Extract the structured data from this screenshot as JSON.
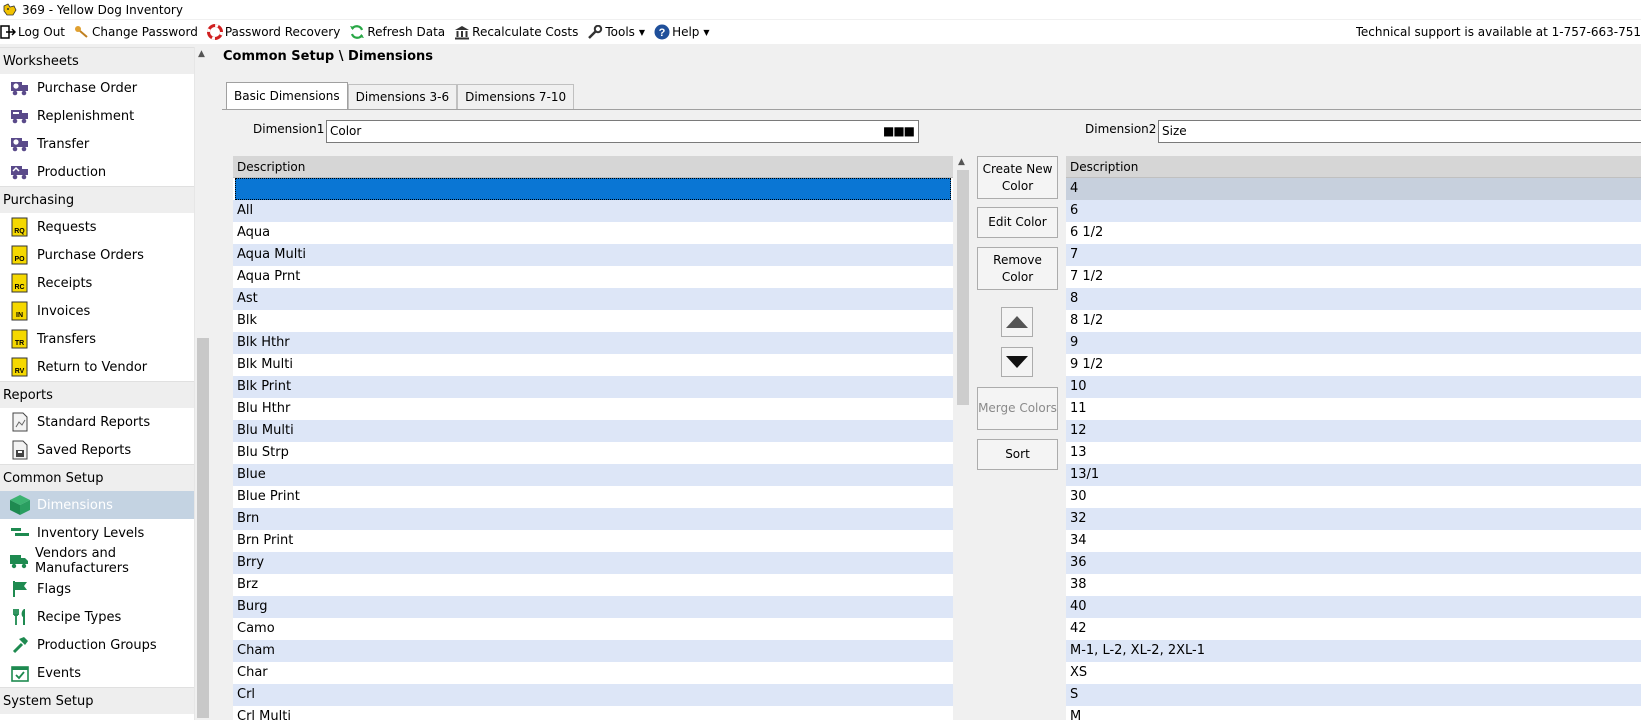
{
  "window": {
    "title": "369  - Yellow Dog Inventory"
  },
  "menubar": {
    "items": [
      {
        "label": "Log Out",
        "icon": "logout-icon"
      },
      {
        "label": "Change Password",
        "icon": "key-icon"
      },
      {
        "label": "Password Recovery",
        "icon": "lifebuoy-icon"
      },
      {
        "label": "Refresh Data",
        "icon": "refresh-icon"
      },
      {
        "label": "Recalculate Costs",
        "icon": "bank-icon"
      },
      {
        "label": "Tools",
        "icon": "wrench-icon"
      },
      {
        "label": "Help",
        "icon": "help-icon"
      }
    ],
    "support_text": "Technical support is available at 1-757-663-751"
  },
  "sidebar": {
    "sections": [
      {
        "header": "Worksheets",
        "items": [
          {
            "label": "Purchase Order",
            "icon": "worksheet-truck-icon"
          },
          {
            "label": "Replenishment",
            "icon": "worksheet-truck-icon"
          },
          {
            "label": "Transfer",
            "icon": "worksheet-truck-icon"
          },
          {
            "label": "Production",
            "icon": "worksheet-truck-icon"
          }
        ]
      },
      {
        "header": "Purchasing",
        "items": [
          {
            "label": "Requests",
            "icon": "doc-badge-icon",
            "badge": "RQ"
          },
          {
            "label": "Purchase Orders",
            "icon": "doc-badge-icon",
            "badge": "PO"
          },
          {
            "label": "Receipts",
            "icon": "doc-badge-icon",
            "badge": "RC"
          },
          {
            "label": "Invoices",
            "icon": "doc-badge-icon",
            "badge": "IN"
          },
          {
            "label": "Transfers",
            "icon": "doc-badge-icon",
            "badge": "TR"
          },
          {
            "label": "Return to Vendor",
            "icon": "doc-badge-icon",
            "badge": "RV"
          }
        ]
      },
      {
        "header": "Reports",
        "items": [
          {
            "label": "Standard Reports",
            "icon": "report-icon"
          },
          {
            "label": "Saved Reports",
            "icon": "saved-report-icon"
          }
        ]
      },
      {
        "header": "Common Setup",
        "items": [
          {
            "label": "Dimensions",
            "icon": "cube-icon",
            "active": true
          },
          {
            "label": "Inventory Levels",
            "icon": "levels-icon"
          },
          {
            "label": "Vendors and Manufacturers",
            "icon": "truck-icon"
          },
          {
            "label": "Flags",
            "icon": "flag-icon"
          },
          {
            "label": "Recipe Types",
            "icon": "utensils-icon"
          },
          {
            "label": "Production Groups",
            "icon": "hammer-icon"
          },
          {
            "label": "Events",
            "icon": "calendar-icon"
          }
        ]
      },
      {
        "header": "System Setup",
        "items": []
      }
    ]
  },
  "main": {
    "breadcrumb": "Common Setup \\ Dimensions",
    "tabs": [
      "Basic Dimensions",
      "Dimensions 3-6",
      "Dimensions 7-10"
    ],
    "dimension1": {
      "label": "Dimension1",
      "value": "Color"
    },
    "dimension2": {
      "label": "Dimension2",
      "value": "Size"
    },
    "grid1": {
      "header": "Description",
      "rows": [
        "",
        "All",
        "Aqua",
        "Aqua Multi",
        "Aqua Prnt",
        "Ast",
        "Blk",
        "Blk Hthr",
        "Blk Multi",
        "Blk Print",
        "Blu Hthr",
        "Blu Multi",
        "Blu Strp",
        "Blue",
        "Blue Print",
        "Brn",
        "Brn Print",
        "Brry",
        "Brz",
        "Burg",
        "Camo",
        "Cham",
        "Char",
        "Crl",
        "Crl Multi"
      ]
    },
    "grid2": {
      "header": "Description",
      "rows": [
        "4",
        "6",
        "6 1/2",
        "7",
        "7 1/2",
        "8",
        "8 1/2",
        "9",
        "9 1/2",
        "10",
        "11",
        "12",
        "13",
        "13/1",
        "30",
        "32",
        "34",
        "36",
        "38",
        "40",
        "42",
        "M-1, L-2, XL-2, 2XL-1",
        "XS",
        "S",
        "M"
      ]
    },
    "buttons": {
      "create": "Create New Color",
      "edit": "Edit Color",
      "remove": "Remove Color",
      "merge": "Merge Colors",
      "sort": "Sort"
    }
  }
}
